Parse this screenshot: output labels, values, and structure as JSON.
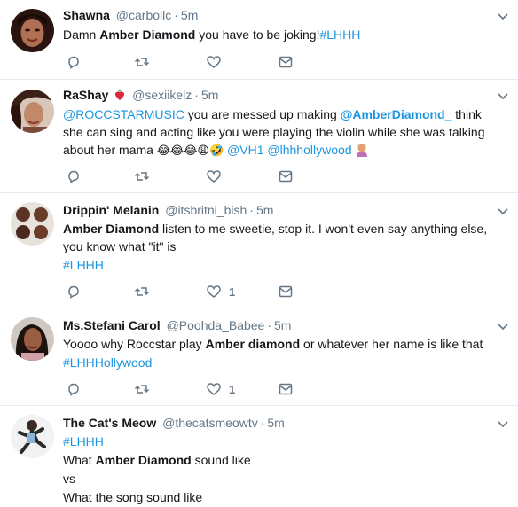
{
  "tweets": [
    {
      "name": "Shawna",
      "handle": "@carbollc",
      "time": "5m",
      "segments": [
        {
          "t": "Damn ",
          "s": "plain"
        },
        {
          "t": "Amber Diamond",
          "s": "bold"
        },
        {
          "t": " you have to be joking!",
          "s": "plain"
        },
        {
          "t": "#LHHH",
          "s": "link"
        }
      ],
      "reply_count": "",
      "retweet_count": "",
      "like_count": ""
    },
    {
      "name": "RaShay",
      "handle": "@sexiikelz",
      "time": "5m",
      "segments": [
        {
          "t": "@ROCCSTARMUSIC",
          "s": "link"
        },
        {
          "t": " you are messed up making ",
          "s": "plain"
        },
        {
          "t": "@AmberDiamond_",
          "s": "linkbold"
        },
        {
          "t": " think she can sing and acting like you were playing the violin while she was talking about her mama ",
          "s": "plain"
        },
        {
          "t": "😂😂😂😩🤣",
          "s": "emoji"
        },
        {
          "t": " ",
          "s": "plain"
        },
        {
          "t": "@VH1",
          "s": "link"
        },
        {
          "t": " ",
          "s": "plain"
        },
        {
          "t": "@lhhhollywood",
          "s": "link"
        }
      ],
      "reply_count": "",
      "retweet_count": "",
      "like_count": ""
    },
    {
      "name": "Drippin' Melanin",
      "handle": "@itsbritni_bish",
      "time": "5m",
      "segments": [
        {
          "t": "Amber Diamond",
          "s": "bold"
        },
        {
          "t": " listen to me sweetie, stop it. I won't even say anything else, you know what \"it\" is",
          "s": "plain"
        }
      ],
      "tag": "#LHHH",
      "reply_count": "",
      "retweet_count": "",
      "like_count": "1"
    },
    {
      "name": "Ms.Stefani Carol",
      "handle": "@Poohda_Babee",
      "time": "5m",
      "segments": [
        {
          "t": "Yoooo why Roccstar play ",
          "s": "plain"
        },
        {
          "t": "Amber diamond",
          "s": "bold"
        },
        {
          "t": " or whatever her name is like that",
          "s": "plain"
        }
      ],
      "tag": "#LHHHollywood",
      "reply_count": "",
      "retweet_count": "",
      "like_count": "1"
    },
    {
      "name": "The Cat's Meow",
      "handle": "@thecatsmeowtv",
      "time": "5m",
      "tag": "#LHHH",
      "lines": [
        {
          "pre": "What ",
          "bold": "Amber Diamond",
          "post": " sound like"
        },
        {
          "pre": "vs",
          "bold": "",
          "post": ""
        },
        {
          "pre": "What the song sound like",
          "bold": "",
          "post": ""
        }
      ]
    }
  ],
  "colors": {
    "link": "#1b95e0",
    "text": "#14171a",
    "muted": "#657786",
    "divider": "#e6ecf0"
  },
  "icons": {
    "reply": "reply-icon",
    "retweet": "retweet-icon",
    "like": "heart-icon",
    "dm": "direct-message-icon",
    "caret": "chevron-down-icon"
  }
}
